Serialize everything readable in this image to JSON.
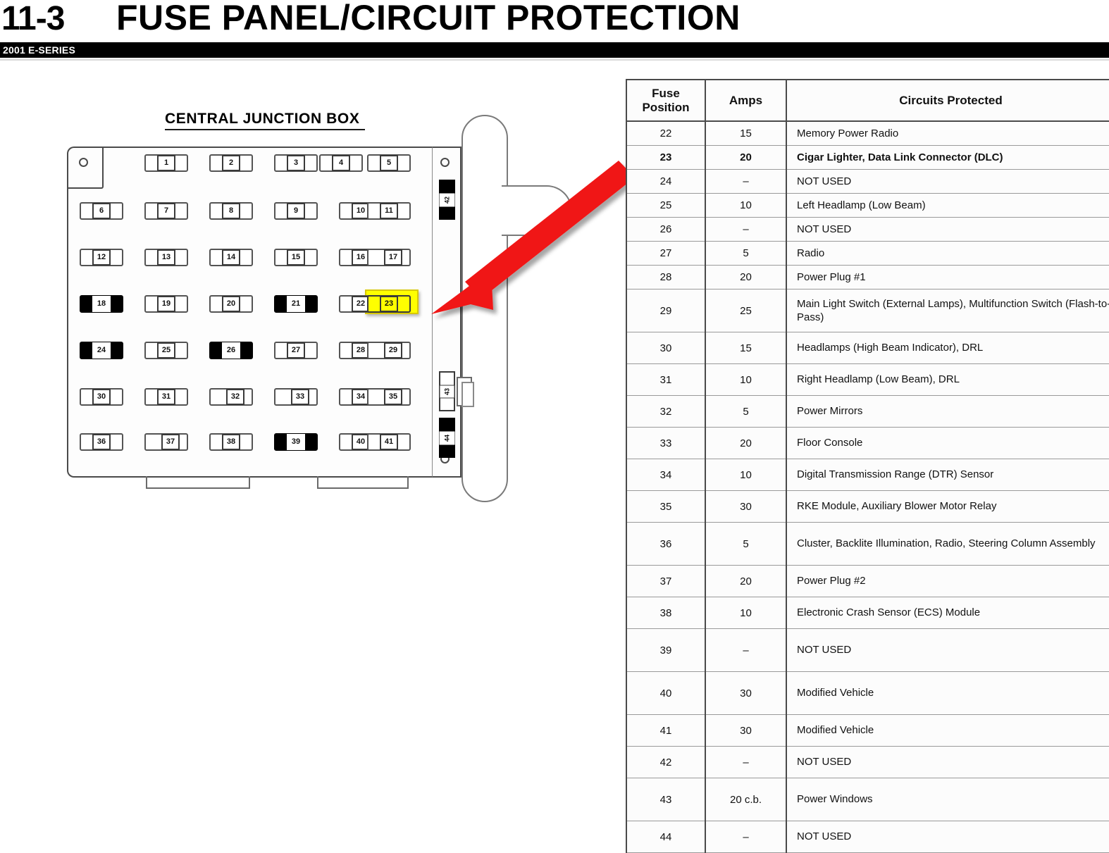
{
  "header": {
    "chapter": "11-3",
    "title": "FUSE PANEL/CIRCUIT PROTECTION",
    "model": "2001 E-SERIES"
  },
  "diagram": {
    "title": "CENTRAL JUNCTION BOX",
    "highlighted_fuse": "23",
    "rows": [
      [
        {
          "n": "1",
          "style": "normal"
        },
        {
          "n": "2",
          "style": "normal"
        },
        {
          "n": "3",
          "style": "normal"
        },
        {
          "n": "4",
          "style": "normal"
        },
        {
          "n": "5",
          "style": "normal"
        }
      ],
      [
        {
          "n": "6",
          "style": "normal"
        },
        {
          "n": "7",
          "style": "normal"
        },
        {
          "n": "8",
          "style": "normal"
        },
        {
          "n": "9",
          "style": "normal"
        },
        {
          "n": "10",
          "style": "normal"
        },
        {
          "n": "11",
          "style": "normal"
        }
      ],
      [
        {
          "n": "12",
          "style": "normal"
        },
        {
          "n": "13",
          "style": "normal"
        },
        {
          "n": "14",
          "style": "normal"
        },
        {
          "n": "15",
          "style": "normal"
        },
        {
          "n": "16",
          "style": "normal"
        },
        {
          "n": "17",
          "style": "shift"
        }
      ],
      [
        {
          "n": "18",
          "style": "big"
        },
        {
          "n": "19",
          "style": "normal"
        },
        {
          "n": "20",
          "style": "normal"
        },
        {
          "n": "21",
          "style": "big"
        },
        {
          "n": "22",
          "style": "normal"
        },
        {
          "n": "23",
          "style": "highlight"
        }
      ],
      [
        {
          "n": "24",
          "style": "big"
        },
        {
          "n": "25",
          "style": "normal"
        },
        {
          "n": "26",
          "style": "big"
        },
        {
          "n": "27",
          "style": "normal"
        },
        {
          "n": "28",
          "style": "normal"
        },
        {
          "n": "29",
          "style": "shift"
        }
      ],
      [
        {
          "n": "30",
          "style": "normal"
        },
        {
          "n": "31",
          "style": "normal"
        },
        {
          "n": "32",
          "style": "shift"
        },
        {
          "n": "33",
          "style": "shift"
        },
        {
          "n": "34",
          "style": "normal"
        },
        {
          "n": "35",
          "style": "shift"
        }
      ],
      [
        {
          "n": "36",
          "style": "normal"
        },
        {
          "n": "37",
          "style": "shift"
        },
        {
          "n": "38",
          "style": "normal"
        },
        {
          "n": "39",
          "style": "big"
        },
        {
          "n": "40",
          "style": "normal"
        },
        {
          "n": "41",
          "style": "normal"
        }
      ]
    ],
    "vertical_fuses": [
      {
        "n": "42",
        "style": "big"
      },
      {
        "n": "43",
        "style": "normal"
      },
      {
        "n": "44",
        "style": "big"
      }
    ],
    "accent_color": "#ff0000",
    "highlight_color": "#ffff00"
  },
  "table": {
    "columns": [
      "Fuse Position",
      "Amps",
      "Circuits Protected"
    ],
    "rows": [
      {
        "pos": "22",
        "amps": "15",
        "circuit": "Memory Power Radio",
        "h": "norm",
        "hl": false
      },
      {
        "pos": "23",
        "amps": "20",
        "circuit": "Cigar Lighter, Data Link Connector (DLC)",
        "h": "norm",
        "hl": true
      },
      {
        "pos": "24",
        "amps": "–",
        "circuit": "NOT USED",
        "h": "norm",
        "hl": false,
        "thickbot": true
      },
      {
        "pos": "25",
        "amps": "10",
        "circuit": "Left  Headlamp (Low Beam)",
        "h": "norm",
        "hl": false
      },
      {
        "pos": "26",
        "amps": "–",
        "circuit": "NOT USED",
        "h": "norm",
        "hl": false
      },
      {
        "pos": "27",
        "amps": "5",
        "circuit": "Radio",
        "h": "norm",
        "hl": false
      },
      {
        "pos": "28",
        "amps": "20",
        "circuit": "Power Plug #1",
        "h": "norm",
        "hl": false,
        "thickbot": true
      },
      {
        "pos": "29",
        "amps": "25",
        "circuit": "Main Light Switch (External Lamps), Multifunction Switch (Flash-to-Pass)",
        "h": "xtall",
        "hl": false,
        "thickbot": true
      },
      {
        "pos": "30",
        "amps": "15",
        "circuit": "Headlamps (High Beam Indicator), DRL",
        "h": "tall",
        "hl": false
      },
      {
        "pos": "31",
        "amps": "10",
        "circuit": "Right Headlamp (Low Beam), DRL",
        "h": "tall",
        "hl": false
      },
      {
        "pos": "32",
        "amps": "5",
        "circuit": "Power Mirrors",
        "h": "tall",
        "hl": false
      },
      {
        "pos": "33",
        "amps": "20",
        "circuit": "Floor Console",
        "h": "tall",
        "hl": false
      },
      {
        "pos": "34",
        "amps": "10",
        "circuit": "Digital Transmission Range (DTR) Sensor",
        "h": "tall",
        "hl": false
      },
      {
        "pos": "35",
        "amps": "30",
        "circuit": "RKE Module, Auxiliary Blower Motor Relay",
        "h": "tall",
        "hl": false
      },
      {
        "pos": "36",
        "amps": "5",
        "circuit": "Cluster, Backlite Illumination, Radio, Steering Column Assembly",
        "h": "xtall",
        "hl": false
      },
      {
        "pos": "37",
        "amps": "20",
        "circuit": "Power Plug #2",
        "h": "tall",
        "hl": false
      },
      {
        "pos": "38",
        "amps": "10",
        "circuit": "Electronic Crash Sensor (ECS) Module",
        "h": "tall",
        "hl": false,
        "thickbot": true
      },
      {
        "pos": "39",
        "amps": "–",
        "circuit": "NOT USED",
        "h": "xtall",
        "hl": false
      },
      {
        "pos": "40",
        "amps": "30",
        "circuit": "Modified  Vehicle",
        "h": "xtall",
        "hl": false,
        "thickbot": true
      },
      {
        "pos": "41",
        "amps": "30",
        "circuit": "Modified Vehicle",
        "h": "tall",
        "hl": false
      },
      {
        "pos": "42",
        "amps": "–",
        "circuit": "NOT USED",
        "h": "tall",
        "hl": false,
        "thickbot": true
      },
      {
        "pos": "43",
        "amps": "20 c.b.",
        "circuit": "Power Windows",
        "h": "xtall",
        "hl": false,
        "thickbot": true
      },
      {
        "pos": "44",
        "amps": "–",
        "circuit": "NOT USED",
        "h": "tall",
        "hl": false
      }
    ]
  }
}
